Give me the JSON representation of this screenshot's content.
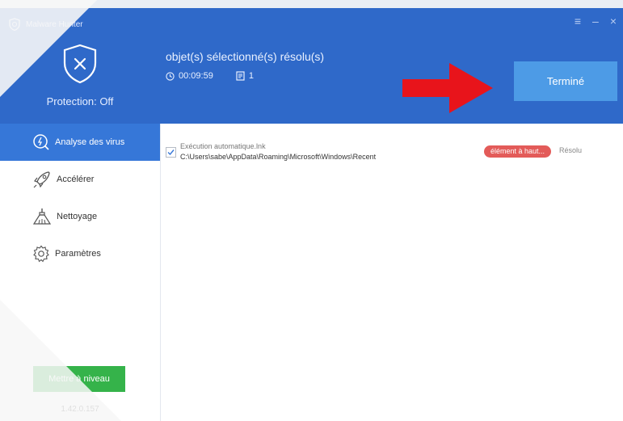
{
  "app": {
    "title": "Malware Hunter",
    "window_controls": [
      "≡",
      "–",
      "×"
    ]
  },
  "protection": {
    "label": "Protection: Off"
  },
  "scan": {
    "headline": "objet(s) sélectionné(s) résolu(s)",
    "elapsed": "00:09:59",
    "count": "1"
  },
  "actions": {
    "done_label": "Terminé"
  },
  "sidebar": {
    "items": [
      {
        "label": "Analyse des virus",
        "icon": "scan-icon",
        "active": true
      },
      {
        "label": "Accélérer",
        "icon": "rocket-icon",
        "active": false
      },
      {
        "label": "Nettoyage",
        "icon": "broom-icon",
        "active": false
      },
      {
        "label": "Paramètres",
        "icon": "gear-icon",
        "active": false
      }
    ],
    "upgrade_label": "Mettre à niveau",
    "version": "1.42.0.157"
  },
  "results": [
    {
      "name": "Exécution automatique.lnk",
      "path": "C:\\Users\\sabe\\AppData\\Roaming\\Microsoft\\Windows\\Recent",
      "risk": "élément à haut...",
      "status": "Résolu",
      "checked": true
    }
  ],
  "colors": {
    "header": "#2f69c9",
    "active_nav": "#3677d8",
    "done_button": "#4d9be6",
    "upgrade_button": "#35b34a",
    "risk_badge": "#e35b59",
    "arrow": "#e8141b"
  }
}
